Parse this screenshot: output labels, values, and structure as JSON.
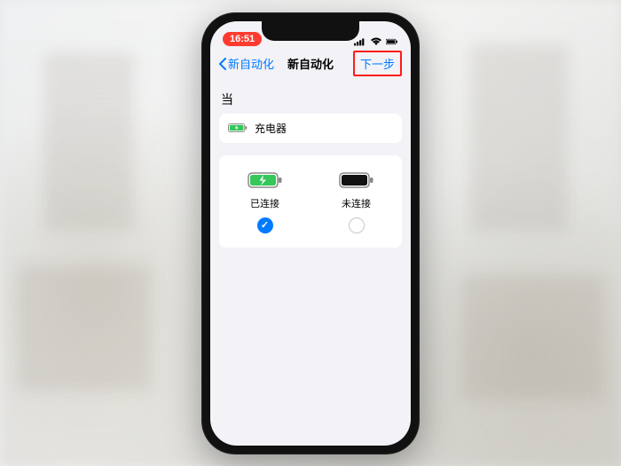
{
  "statusbar": {
    "time": "16:51"
  },
  "nav": {
    "back_label": "新自动化",
    "title": "新自动化",
    "next_label": "下一步"
  },
  "when": {
    "label": "当"
  },
  "trigger": {
    "label": "充电器"
  },
  "options": {
    "connected": {
      "label": "已连接",
      "selected": true
    },
    "disconnected": {
      "label": "未连接",
      "selected": false
    }
  },
  "colors": {
    "accent": "#007aff",
    "highlight": "#ff1a1a",
    "green": "#34c759"
  }
}
